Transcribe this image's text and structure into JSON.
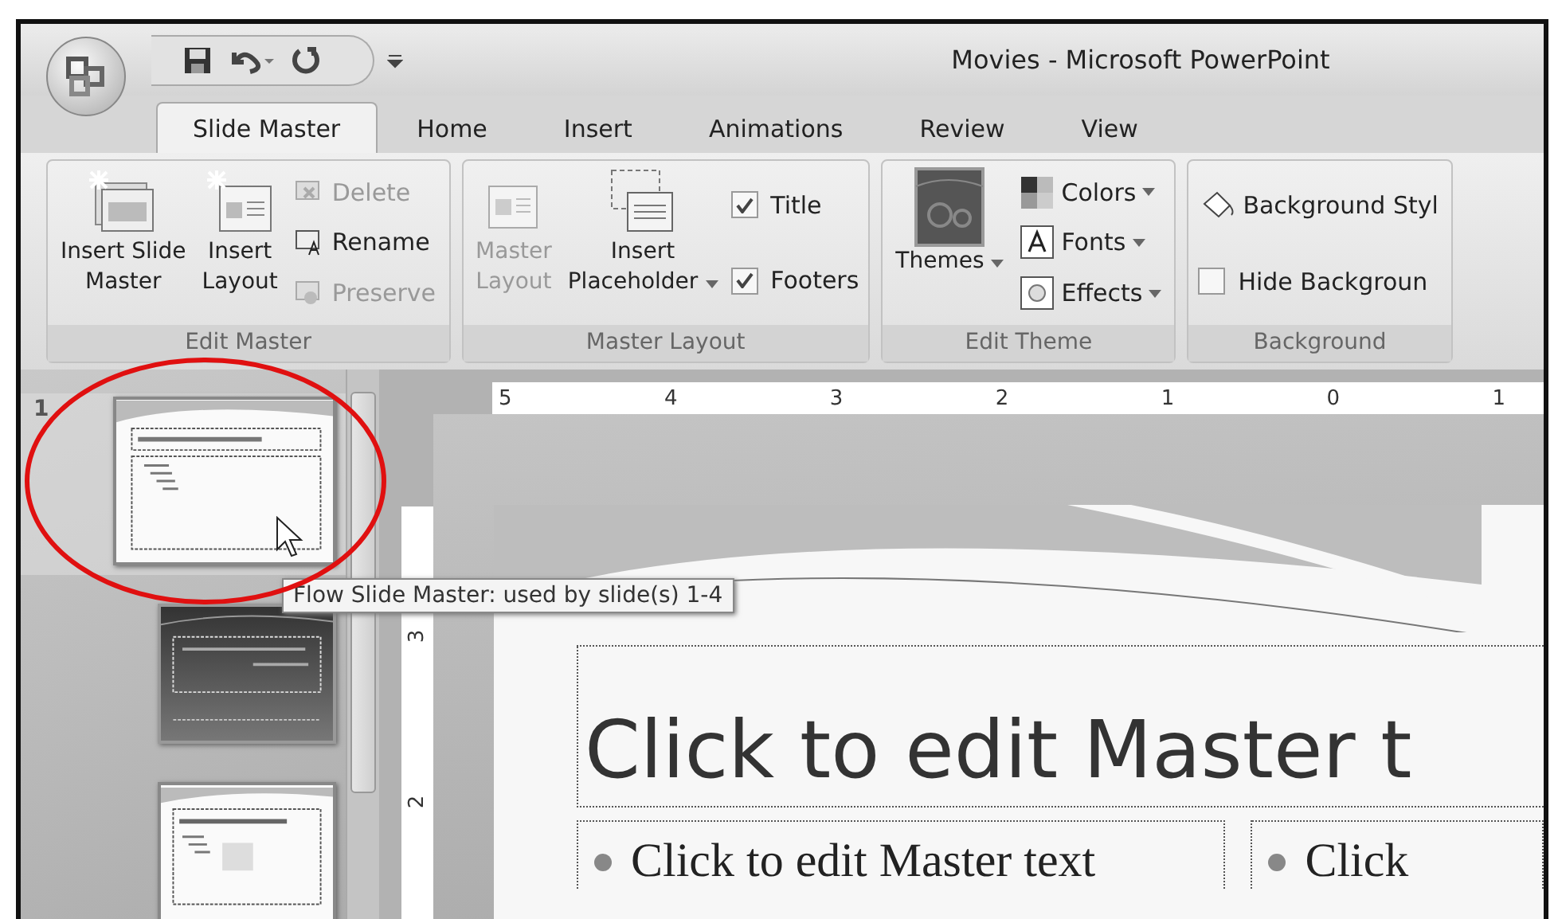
{
  "window": {
    "title": "Movies - Microsoft PowerPoint"
  },
  "tabs": [
    {
      "label": "Slide Master",
      "selected": true
    },
    {
      "label": "Home",
      "selected": false
    },
    {
      "label": "Insert",
      "selected": false
    },
    {
      "label": "Animations",
      "selected": false
    },
    {
      "label": "Review",
      "selected": false
    },
    {
      "label": "View",
      "selected": false
    }
  ],
  "ribbon": [
    {
      "label": "Edit Master",
      "items": [
        {
          "kind": "large",
          "lines": [
            "Insert Slide",
            "Master"
          ],
          "disabled": false
        },
        {
          "kind": "large",
          "lines": [
            "Insert",
            "Layout"
          ],
          "disabled": false
        },
        {
          "kind": "stack",
          "entries": [
            {
              "kind": "small",
              "label": "Delete",
              "disabled": true
            },
            {
              "kind": "small",
              "label": "Rename",
              "disabled": false
            },
            {
              "kind": "small",
              "label": "Preserve",
              "disabled": true
            }
          ]
        }
      ]
    },
    {
      "label": "Master Layout",
      "items": [
        {
          "kind": "large",
          "lines": [
            "Master",
            "Layout"
          ],
          "disabled": true
        },
        {
          "kind": "large",
          "lines": [
            "Insert",
            "Placeholder"
          ],
          "disabled": false,
          "dropdown": true
        },
        {
          "kind": "stack",
          "entries": [
            {
              "kind": "check",
              "label": "Title",
              "checked": true
            },
            {
              "kind": "check",
              "label": "Footers",
              "checked": true
            }
          ]
        }
      ]
    },
    {
      "label": "Edit Theme",
      "items": [
        {
          "kind": "large",
          "lines": [
            "Themes"
          ],
          "disabled": false,
          "dropdown": true
        },
        {
          "kind": "stack",
          "entries": [
            {
              "kind": "small",
              "label": "Colors",
              "disabled": false,
              "dropdown": true
            },
            {
              "kind": "small",
              "label": "Fonts",
              "disabled": false,
              "dropdown": true
            },
            {
              "kind": "small",
              "label": "Effects",
              "disabled": false,
              "dropdown": true
            }
          ]
        }
      ]
    },
    {
      "label": "Background",
      "items": [
        {
          "kind": "stack",
          "entries": [
            {
              "kind": "small",
              "label": "Background Styl",
              "disabled": false
            },
            {
              "kind": "check",
              "label": "Hide Backgroun",
              "checked": false
            }
          ]
        }
      ]
    }
  ],
  "slides": [
    {
      "number": "1",
      "kind": "master",
      "selected": true
    },
    {
      "kind": "title-layout",
      "selected": false
    },
    {
      "kind": "content-layout",
      "selected": false
    }
  ],
  "tooltip": "Flow Slide Master: used by slide(s) 1-4",
  "hruler": [
    "5",
    "4",
    "3",
    "2",
    "1",
    "0",
    "1"
  ],
  "vruler": [
    "3",
    "2"
  ],
  "slide": {
    "title": "Click to edit Master t",
    "bodies": [
      {
        "text": "Click to edit Master text"
      },
      {
        "text": "Click"
      }
    ]
  }
}
